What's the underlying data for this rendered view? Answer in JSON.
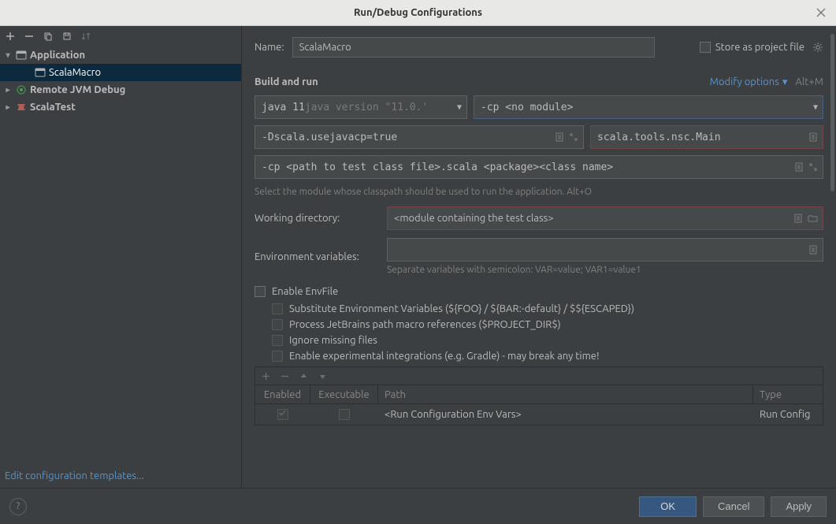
{
  "titlebar": {
    "title": "Run/Debug Configurations"
  },
  "tree": {
    "application": "Application",
    "scalaMacro": "ScalaMacro",
    "remoteJvm": "Remote JVM Debug",
    "scalaTest": "ScalaTest"
  },
  "editTemplates": "Edit configuration templates...",
  "form": {
    "nameLabel": "Name:",
    "nameValue": "ScalaMacro",
    "storeAsProject": "Store as project file",
    "buildRunTitle": "Build and run",
    "modifyOptions": "Modify options",
    "modifyShortcut": "Alt+M",
    "jdkPrefix": "java 11 ",
    "jdkFaded": "java version \"11.0.'",
    "moduleCp": "-cp <no module>",
    "vmOptions": "-Dscala.usejavacp=true",
    "mainClass": "scala.tools.nsc.Main",
    "programArgs": "-cp <path to test class file>.scala <package><class name>",
    "moduleHint": "Select the module whose classpath should be used to run the application.  Alt+O",
    "workingDirLabel": "Working directory:",
    "workingDirValue": "<module containing the test class>",
    "envVarsLabel": "Environment variables:",
    "envVarsHint": "Separate variables with semicolon: VAR=value;  VAR1=value1",
    "enableEnvFile": "Enable EnvFile",
    "subSubstitute": "Substitute Environment Variables (${FOO} / ${BAR:-default} / $${ESCAPED})",
    "subProcess": "Process JetBrains path macro references ($PROJECT_DIR$)",
    "subIgnore": "Ignore missing files",
    "subExperimental": "Enable experimental integrations (e.g. Gradle) - may break any time!"
  },
  "envTable": {
    "colEnabled": "Enabled",
    "colExec": "Executable",
    "colPath": "Path",
    "colType": "Type",
    "row1Path": "<Run Configuration Env Vars>",
    "row1Type": "Run Config"
  },
  "footer": {
    "ok": "OK",
    "cancel": "Cancel",
    "apply": "Apply"
  }
}
